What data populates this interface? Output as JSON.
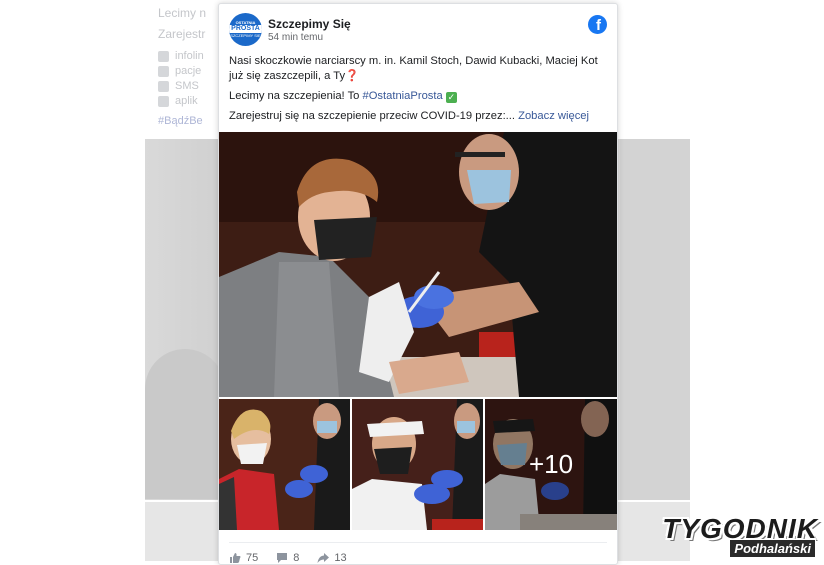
{
  "background": {
    "line1": "Lecimy n",
    "line2": "Zarejestr",
    "list": [
      "infolin",
      "pacje",
      "SMS",
      "aplik"
    ],
    "hashtag": "#BądźBe"
  },
  "post": {
    "page_name": "Szczepimy Się",
    "timestamp": "54 min temu",
    "avatar": {
      "top": "PROSTA",
      "small1": "OSTATNIA",
      "small2": "SZCZEPIMY SIĘ"
    },
    "paragraph1": "Nasi skoczkowie narciarscy m. in. Kamil Stoch, Dawid Kubacki, Maciej Kot już się zaszczepili, a Ty",
    "paragraph1_emoji": "❓",
    "paragraph2_prefix": "Lecimy na szczepienia! To ",
    "paragraph2_hashtag": "#OstatniaProsta",
    "paragraph2_emoji": "✓",
    "paragraph3_text": "Zarejestruj się na szczepienie przeciw COVID-19 przez:...",
    "see_more": "Zobacz więcej",
    "more_photos": "+10"
  },
  "reactions": {
    "likes": "75",
    "comments": "8",
    "shares": "13"
  },
  "watermark": {
    "main": "TYGODNIK",
    "sub": "Podhalański"
  },
  "colors": {
    "facebook_blue": "#1877f2",
    "link": "#385898",
    "avatar": "#1b69c9"
  }
}
